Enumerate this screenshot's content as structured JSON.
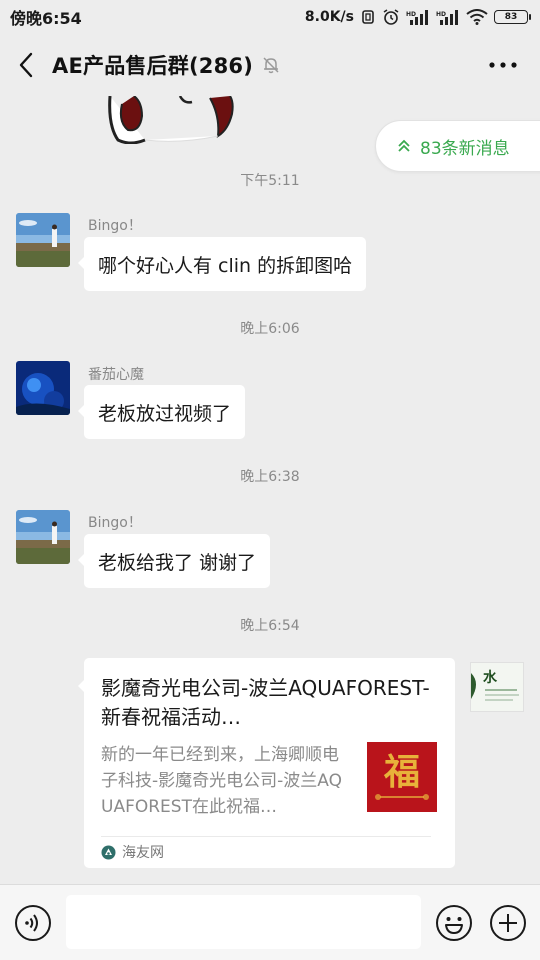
{
  "status_bar": {
    "time": "傍晚6:54",
    "speed": "8.0K/s",
    "battery": "83"
  },
  "header": {
    "title": "AE产品售后群(286)"
  },
  "new_messages": {
    "label": "83条新消息"
  },
  "messages": [
    {
      "time": "下午5:11",
      "sender": "Bingo！",
      "text": "哪个好心人有 clin 的拆卸图哈"
    },
    {
      "time": "晚上6:06",
      "sender": "番茄心魔",
      "text": "老板放过视频了"
    },
    {
      "time": "晚上6:38",
      "sender": "Bingo！",
      "text": "老板给我了 谢谢了"
    },
    {
      "time": "晚上6:54"
    }
  ],
  "link_card": {
    "title": "影魔奇光电公司-波兰AQUAFOREST-新春祝福活动…",
    "description": "新的一年已经到来，上海卿顺电子科技-影魔奇光电公司-波兰AQUAFOREST在此祝福…",
    "thumb_text": "福",
    "source": "海友网"
  },
  "side_thumb": {
    "text": "水"
  },
  "colors": {
    "accent_green": "#3aa94f",
    "background": "#ededed"
  }
}
